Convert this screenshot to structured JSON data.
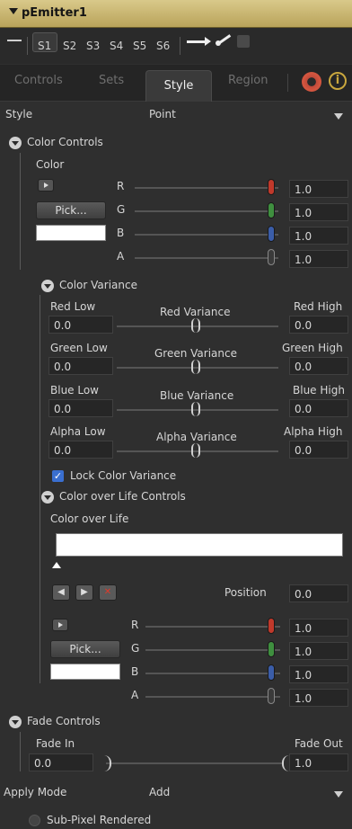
{
  "header": {
    "title": "pEmitter1"
  },
  "sets": {
    "items": [
      "S1",
      "S2",
      "S3",
      "S4",
      "S5",
      "S6"
    ]
  },
  "tabs": {
    "controls": "Controls",
    "sets": "Sets",
    "style": "Style",
    "region": "Region"
  },
  "style_row": {
    "label": "Style",
    "value": "Point"
  },
  "color_controls": {
    "header": "Color Controls",
    "color_label": "Color",
    "pick_label": "Pick...",
    "channels": [
      {
        "label": "R",
        "value": "1.0",
        "color": "#c0392b"
      },
      {
        "label": "G",
        "value": "1.0",
        "color": "#3f8f3f"
      },
      {
        "label": "B",
        "value": "1.0",
        "color": "#3b5da8"
      },
      {
        "label": "A",
        "value": "1.0",
        "color": "#3a3a3a"
      }
    ]
  },
  "color_variance": {
    "header": "Color Variance",
    "rows": [
      {
        "low_label": "Red Low",
        "low_value": "0.0",
        "center": "Red Variance",
        "high_label": "Red High",
        "high_value": "0.0"
      },
      {
        "low_label": "Green Low",
        "low_value": "0.0",
        "center": "Green Variance",
        "high_label": "Green High",
        "high_value": "0.0"
      },
      {
        "low_label": "Blue Low",
        "low_value": "0.0",
        "center": "Blue Variance",
        "high_label": "Blue High",
        "high_value": "0.0"
      },
      {
        "low_label": "Alpha Low",
        "low_value": "0.0",
        "center": "Alpha Variance",
        "high_label": "Alpha High",
        "high_value": "0.0"
      }
    ],
    "lock_label": "Lock Color Variance"
  },
  "color_over_life": {
    "header": "Color over Life Controls",
    "label": "Color over Life",
    "position_label": "Position",
    "position_value": "0.0",
    "pick_label": "Pick...",
    "channels": [
      {
        "label": "R",
        "value": "1.0",
        "color": "#c0392b"
      },
      {
        "label": "G",
        "value": "1.0",
        "color": "#3f8f3f"
      },
      {
        "label": "B",
        "value": "1.0",
        "color": "#3b5da8"
      },
      {
        "label": "A",
        "value": "1.0",
        "color": "#3a3a3a"
      }
    ]
  },
  "fade_controls": {
    "header": "Fade Controls",
    "fade_in_label": "Fade In",
    "fade_out_label": "Fade Out",
    "fade_in_value": "0.0",
    "fade_out_value": "1.0"
  },
  "apply_mode": {
    "label": "Apply Mode",
    "value": "Add"
  },
  "subpixel": {
    "label": "Sub-Pixel Rendered"
  }
}
